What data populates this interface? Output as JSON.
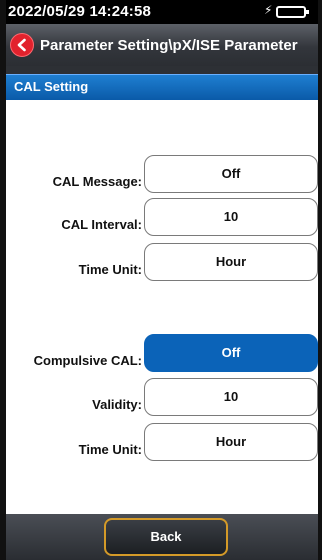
{
  "status_bar": {
    "datetime": "2022/05/29 14:24:58",
    "battery_icon": "battery-charging-icon"
  },
  "header": {
    "back_icon": "chevron-left-icon",
    "title": "Parameter Setting\\pX/ISE Parameter"
  },
  "section": {
    "title": "CAL Setting"
  },
  "settings": [
    {
      "label": "CAL Message:",
      "value": "Off"
    },
    {
      "label": "CAL Interval:",
      "value": "10"
    },
    {
      "label": "Time Unit:",
      "value": "Hour"
    },
    {
      "label": "Compulsive CAL:",
      "value": "Off",
      "selected": true
    },
    {
      "label": "Validity:",
      "value": "10"
    },
    {
      "label": "Time Unit:",
      "value": "Hour"
    }
  ],
  "footer": {
    "back_label": "Back"
  },
  "colors": {
    "accent_blue": "#0b63b8",
    "back_red": "#e2222d",
    "button_border": "#d49a28"
  }
}
